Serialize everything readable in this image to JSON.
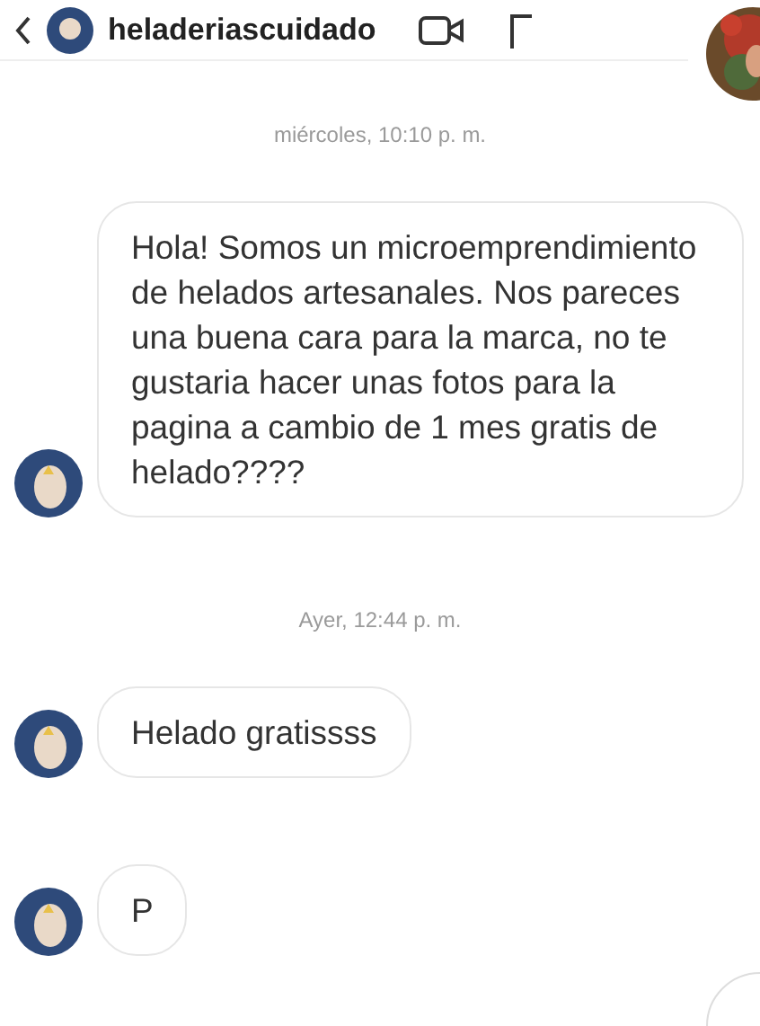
{
  "header": {
    "username": "heladeriascuidado"
  },
  "messages": [
    {
      "kind": "time",
      "text": "miércoles, 10:10 p. m."
    },
    {
      "kind": "received",
      "text": "Hola! Somos un microemprendimiento de helados artesanales. Nos pareces una buena cara para la marca, no te gustaria hacer unas fotos para la pagina a cambio de 1 mes gratis de helado????"
    },
    {
      "kind": "time",
      "text": "Ayer, 12:44 p. m."
    },
    {
      "kind": "received",
      "text": "Helado gratissss"
    },
    {
      "kind": "received",
      "text": "P"
    }
  ]
}
